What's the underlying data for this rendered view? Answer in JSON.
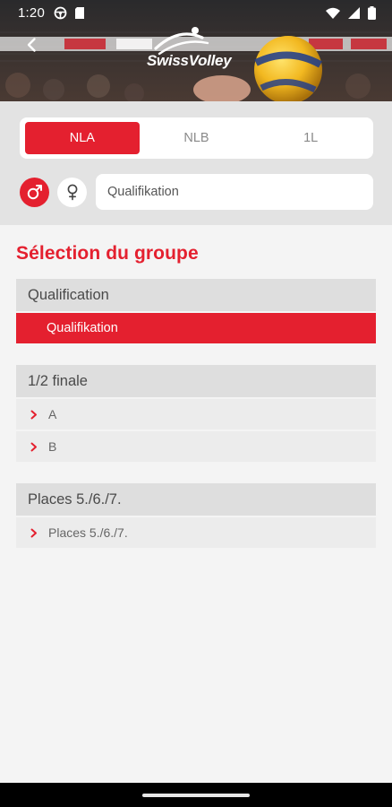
{
  "status_bar": {
    "time": "1:20"
  },
  "header": {
    "logo_text": "SwissVolley"
  },
  "filters": {
    "league_tabs": [
      {
        "label": "NLA",
        "active": true
      },
      {
        "label": "NLB",
        "active": false
      },
      {
        "label": "1L",
        "active": false
      }
    ],
    "gender": {
      "male_symbol": "♂",
      "female_symbol": "♀",
      "selected": "male"
    },
    "phase_value": "Qualifikation"
  },
  "content": {
    "title": "Sélection du groupe",
    "groups": [
      {
        "header": "Qualification",
        "items": [
          {
            "label": "Qualifikation",
            "selected": true
          }
        ]
      },
      {
        "header": "1/2 finale",
        "items": [
          {
            "label": "A",
            "selected": false
          },
          {
            "label": "B",
            "selected": false
          }
        ]
      },
      {
        "header": "Places 5./6./7.",
        "items": [
          {
            "label": "Places 5./6./7.",
            "selected": false
          }
        ]
      }
    ]
  },
  "colors": {
    "accent": "#e4202f",
    "panel": "#e3e3e3",
    "background": "#f4f4f4"
  },
  "icons": {
    "back": "arrow-left-icon",
    "chevron": "chevron-right-icon",
    "wifi": "wifi-icon",
    "signal": "signal-icon",
    "battery": "battery-icon"
  }
}
